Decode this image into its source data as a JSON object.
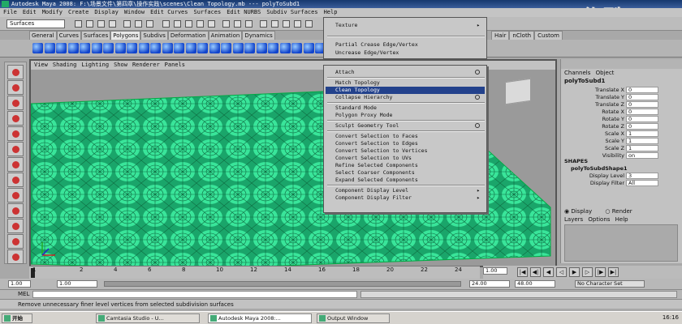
{
  "window": {
    "title": "Autodesk Maya 2008: F:\\场景文件\\第四章\\操作实践\\scenes\\Clean Topology.mb   ---   polyToSubd1"
  },
  "watermark": "佐酷",
  "main_menu": [
    "File",
    "Edit",
    "Modify",
    "Create",
    "Display",
    "Window",
    "Edit Curves",
    "Surfaces",
    "Edit NURBS",
    "Subdiv Surfaces",
    "Help"
  ],
  "status_line": {
    "mode": "Surfaces"
  },
  "shelf_tabs": [
    "General",
    "Curves",
    "Surfaces",
    "Polygons",
    "Subdivs",
    "Deformation",
    "Animation",
    "Dynamics"
  ],
  "shelf_tabs_right": [
    "Hair",
    "nCloth",
    "Custom"
  ],
  "shelf_active": "Polygons",
  "viewport_menu": [
    "View",
    "Shading",
    "Lighting",
    "Show",
    "Renderer",
    "Panels"
  ],
  "top_menu": {
    "items": [
      "Texture",
      "Partial Crease Edge/Vertex",
      "Uncrease Edge/Vertex"
    ]
  },
  "context_menu": {
    "highlighted": "Clean Topology",
    "items": [
      {
        "label": "Attach",
        "option": true
      },
      {
        "sep": true
      },
      {
        "label": "Match Topology"
      },
      {
        "label": "Clean Topology"
      },
      {
        "label": "Collapse Hierarchy",
        "option": true
      },
      {
        "sep": true
      },
      {
        "label": "Standard Mode"
      },
      {
        "label": "Polygon Proxy Mode"
      },
      {
        "sep": true
      },
      {
        "label": "Sculpt Geometry Tool",
        "option": true
      },
      {
        "sep": true
      },
      {
        "label": "Convert Selection to Faces"
      },
      {
        "label": "Convert Selection to Edges"
      },
      {
        "label": "Convert Selection to Vertices"
      },
      {
        "label": "Convert Selection to UVs"
      },
      {
        "label": "Refine Selected Components"
      },
      {
        "label": "Select Coarser Components"
      },
      {
        "label": "Expand Selected Components"
      },
      {
        "sep": true
      },
      {
        "label": "Component Display Level",
        "submenu": true
      },
      {
        "label": "Component Display Filter",
        "submenu": true
      }
    ]
  },
  "channel_box": {
    "tabs": [
      "Channels",
      "Object"
    ],
    "object_name": "polyToSubd1",
    "attributes": [
      {
        "label": "Translate X",
        "value": "0"
      },
      {
        "label": "Translate Y",
        "value": "0"
      },
      {
        "label": "Translate Z",
        "value": "0"
      },
      {
        "label": "Rotate X",
        "value": "0"
      },
      {
        "label": "Rotate Y",
        "value": "0"
      },
      {
        "label": "Rotate Z",
        "value": "0"
      },
      {
        "label": "Scale X",
        "value": "1"
      },
      {
        "label": "Scale Y",
        "value": "1"
      },
      {
        "label": "Scale Z",
        "value": "1"
      },
      {
        "label": "Visibility",
        "value": "on"
      }
    ],
    "shapes_header": "SHAPES",
    "shape_name": "polyToSubdShape1",
    "shape_attributes": [
      {
        "label": "Display Level",
        "value": "3"
      },
      {
        "label": "Display Filter",
        "value": "All"
      }
    ],
    "layer_radio": [
      "Display",
      "Render"
    ],
    "layer_menu": [
      "Layers",
      "Options",
      "Help"
    ]
  },
  "time_slider": {
    "ticks": [
      "1",
      "2",
      "4",
      "6",
      "8",
      "10",
      "12",
      "14",
      "16",
      "18",
      "20",
      "22",
      "24"
    ],
    "current_frame": "1.00"
  },
  "range_slider": {
    "start": "1.00",
    "playback_start": "1.00",
    "end_value": "24.00",
    "playback_end": "48.00",
    "character_set": "No Character Set"
  },
  "command_line": {
    "label": "MEL"
  },
  "help_line": "Remove unnecessary finer level vertices from selected subdivision surfaces",
  "taskbar": {
    "start": "开始",
    "tasks": [
      "Camtasia Studio - U...",
      "Autodesk Maya 2008:...",
      "Output Window"
    ],
    "clock": "16:16"
  }
}
